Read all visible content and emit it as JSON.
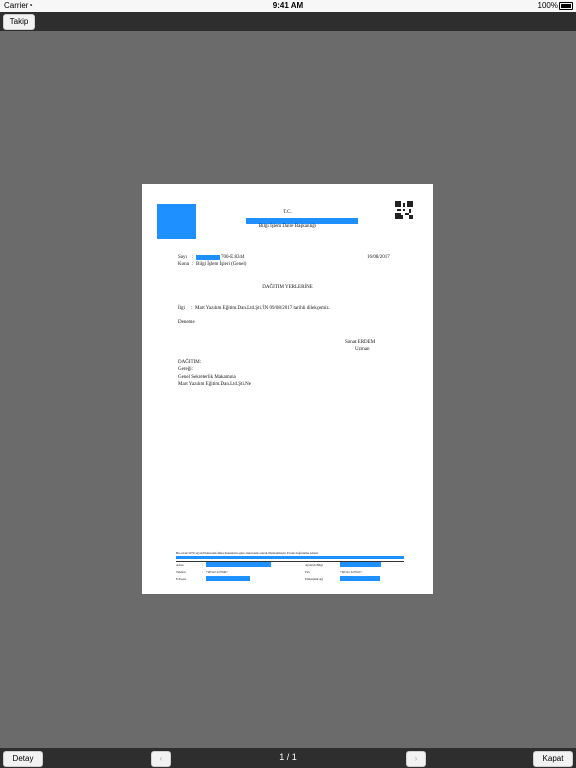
{
  "status": {
    "carrier": "Carrier",
    "time": "9:41 AM",
    "battery": "100%"
  },
  "toolbar": {
    "follow_label": "Takip"
  },
  "bottom": {
    "detail_label": "Detay",
    "close_label": "Kapat",
    "pager": "1 / 1",
    "prev": "‹",
    "next": "›"
  },
  "doc": {
    "header_tc": "T.C.",
    "department": "Bilgi İşlem Daire Başkanlığı",
    "sayi_label": "Sayı",
    "sayi_value": "700-E.8344",
    "date": "16/08/2017",
    "konu_label": "Konu",
    "konu_value": "Bilgi İşlem İşleri (Genel)",
    "to": "DAĞITIM YERLERİNE",
    "ilgi_label": "İlgi",
    "ilgi_value": "Mart Yazılım Eğitim.Dan.Ltd.Şti.'İN 09/08/2017 tarihli dilekçemiz.",
    "body": "Deneme",
    "signer_name": "Sonat ERDEM",
    "signer_title": "Uzman",
    "distribution_title": "DAĞITIM:",
    "distribution_sub": "Gereği:",
    "distribution_items": [
      "Genel Sekreterlik Makamına",
      "Mart Yazılım Eğitim.Dan.Ltd.Şti.Ne"
    ],
    "footer_note": "Bu evrak 5070 sayılı Elektronik İmza Kanunu'na göre elektronik olarak imzalanmıştır. Evrak doğrulama adresi:",
    "footer": {
      "adres_label": "Adres",
      "telefon_label": "Telefon",
      "telefon_value": "+90312 2270007",
      "eposta_label": "E-Posta",
      "ayrinti_label": "Ayrıntılı Bilgi",
      "fax_label": "Fax",
      "fax_value": "+90312 2270107",
      "elektronik_label": "Elektronik Ağ"
    }
  },
  "colors": {
    "redaction": "#1e90ff",
    "chrome": "#2e2e2e",
    "backdrop": "#6b6b6b"
  }
}
